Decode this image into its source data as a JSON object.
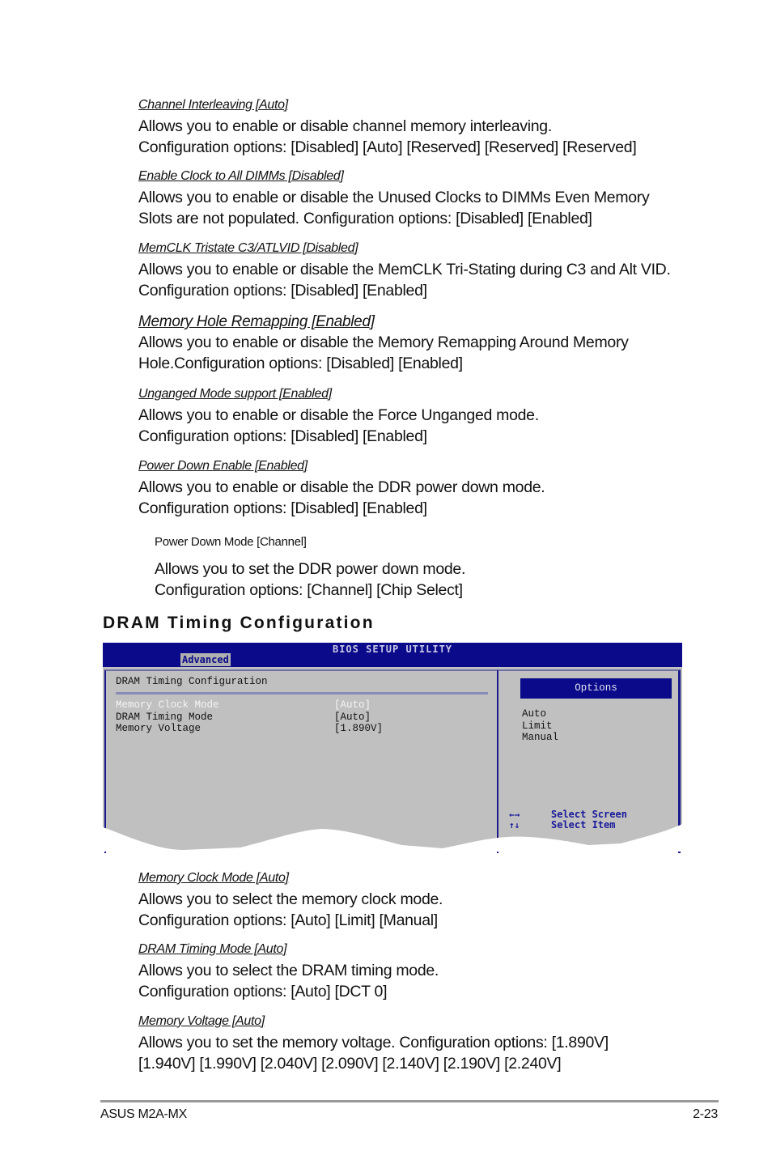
{
  "items": [
    {
      "title": "Channel Interleaving [Auto]",
      "desc": [
        "Allows you to enable or disable channel memory interleaving.",
        "Configuration options: [Disabled] [Auto] [Reserved] [Reserved] [Reserved]"
      ]
    },
    {
      "title": "Enable Clock to All DIMMs [Disabled]",
      "desc": [
        "Allows you to enable or disable the Unused Clocks to DIMMs Even Memory",
        "Slots are not populated. Configuration options: [Disabled] [Enabled]"
      ]
    },
    {
      "title": "MemCLK Tristate C3/ATLVID [Disabled]",
      "desc": [
        "Allows you to enable or disable the MemCLK Tri-Stating during C3 and Alt VID.",
        "Configuration options: [Disabled] [Enabled]"
      ]
    },
    {
      "title": "Memory Hole Remapping [Enabled]",
      "desc": [
        "Allows you to enable or disable the Memory Remapping Around Memory",
        "Hole.Configuration options: [Disabled] [Enabled]"
      ]
    },
    {
      "title": "Unganged Mode support [Enabled]",
      "desc": [
        "Allows you to enable or disable the Force Unganged mode.",
        "Configuration options: [Disabled] [Enabled]"
      ]
    },
    {
      "title": "Power Down Enable [Enabled]",
      "desc": [
        "Allows you to enable or disable the DDR power down mode.",
        "Configuration options: [Disabled] [Enabled]"
      ]
    },
    {
      "title": "Power Down Mode [Channel]",
      "desc": [
        "Allows you to set the DDR power down mode.",
        "Configuration options: [Channel] [Chip Select]"
      ]
    }
  ],
  "section_heading": "DRAM Timing Configuration",
  "bios": {
    "title": "BIOS SETUP UTILITY",
    "active_tab": "Advanced",
    "panel_heading": "DRAM Timing Configuration",
    "rows": [
      {
        "label": "Memory Clock Mode",
        "value": "[Auto]",
        "selected": true
      },
      {
        "label": "DRAM Timing Mode",
        "value": "[Auto]",
        "selected": false
      },
      {
        "label": "Memory Voltage",
        "value": "[1.890V]",
        "selected": false
      }
    ],
    "options_heading": "Options",
    "options": [
      "Auto",
      "Limit",
      "Manual"
    ],
    "help": [
      {
        "key": "←→",
        "text": "Select Screen",
        "icon": "left-right-arrows-icon"
      },
      {
        "key": "↑↓",
        "text": "Select Item",
        "icon": "up-down-arrows-icon"
      }
    ],
    "colors": {
      "header_bg": "#0a0a8a",
      "panel_bg": "#c0c0c0",
      "help_text": "#1a1a9a"
    }
  },
  "items2": [
    {
      "title": "Memory Clock Mode [Auto]",
      "desc": [
        "Allows you to select the memory clock mode.",
        "Configuration options: [Auto] [Limit] [Manual]"
      ]
    },
    {
      "title": "DRAM Timing Mode [Auto]",
      "desc": [
        "Allows you to select the DRAM timing mode.",
        "Configuration options: [Auto] [DCT 0]"
      ]
    },
    {
      "title": "Memory Voltage [Auto]",
      "desc": [
        "Allows you to set the memory voltage. Configuration options: [1.890V]",
        "[1.940V] [1.990V] [2.040V] [2.090V] [2.140V] [2.190V] [2.240V]"
      ]
    }
  ],
  "footer": {
    "left": "ASUS M2A-MX",
    "right": "2-23"
  }
}
